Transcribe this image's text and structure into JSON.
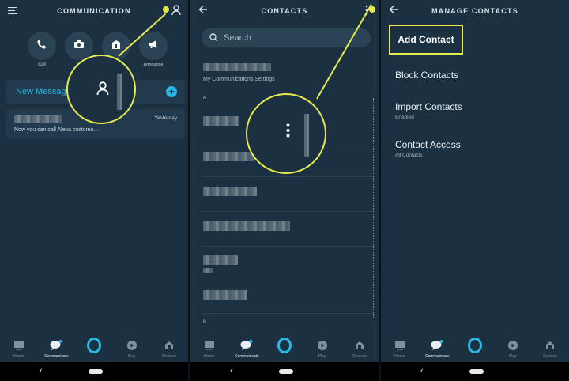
{
  "screens": [
    {
      "header": {
        "title": "COMMUNICATION",
        "left_icon": "hamburger-icon",
        "right_icon": "person-icon"
      },
      "quick_actions": [
        {
          "label": "Call",
          "icon": "phone-icon"
        },
        {
          "label": "",
          "icon": "camera-icon"
        },
        {
          "label": "",
          "icon": "drop-in-icon"
        },
        {
          "label": "Announce",
          "icon": "megaphone-icon"
        }
      ],
      "new_message_label": "New Message",
      "new_message_plus": "+",
      "conversation": {
        "preview": "Now you can call Alexa custome...",
        "time": "Yesterday"
      }
    },
    {
      "header": {
        "title": "CONTACTS",
        "left_icon": "back-arrow-icon",
        "right_icon": "more-vertical-icon"
      },
      "search_placeholder": "Search",
      "my_settings": "My Communications Settings",
      "section_a": "A",
      "section_b": "B"
    },
    {
      "header": {
        "title": "MANAGE CONTACTS",
        "left_icon": "back-arrow-icon"
      },
      "menu": [
        {
          "label": "Add Contact",
          "sub": ""
        },
        {
          "label": "Block Contacts",
          "sub": ""
        },
        {
          "label": "Import Contacts",
          "sub": "Enabled"
        },
        {
          "label": "Contact Access",
          "sub": "All Contacts"
        }
      ]
    }
  ],
  "bottom_nav": [
    {
      "label": "Home",
      "icon": "home-icon"
    },
    {
      "label": "Communicate",
      "icon": "chat-bubble-icon"
    },
    {
      "label": "",
      "icon": "alexa-icon"
    },
    {
      "label": "Play",
      "icon": "play-icon"
    },
    {
      "label": "Devices",
      "icon": "devices-icon"
    }
  ],
  "system_bar": {
    "back": "‹"
  },
  "colors": {
    "background": "#1b3142",
    "accent": "#28b8e6",
    "highlight": "#e6ea4d"
  }
}
